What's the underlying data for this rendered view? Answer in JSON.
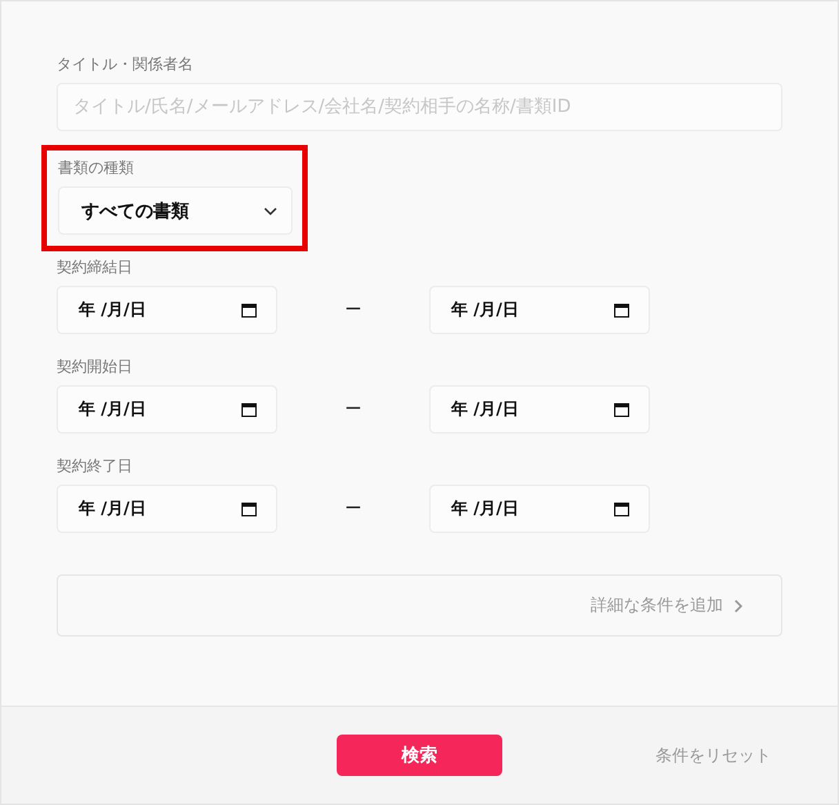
{
  "title_field": {
    "label": "タイトル・関係者名",
    "placeholder": "タイトル/氏名/メールアドレス/会社名/契約相手の名称/書類ID"
  },
  "doc_type": {
    "label": "書類の種類",
    "value": "すべての書類",
    "highlighted": true
  },
  "date_ranges": [
    {
      "label": "契約締結日",
      "from": "年 /月/日",
      "separator": "ー",
      "to": "年 /月/日"
    },
    {
      "label": "契約開始日",
      "from": "年 /月/日",
      "separator": "ー",
      "to": "年 /月/日"
    },
    {
      "label": "契約終了日",
      "from": "年 /月/日",
      "separator": "ー",
      "to": "年 /月/日"
    }
  ],
  "more_conditions": "詳細な条件を追加",
  "search_button": "検索",
  "reset_link": "条件をリセット"
}
